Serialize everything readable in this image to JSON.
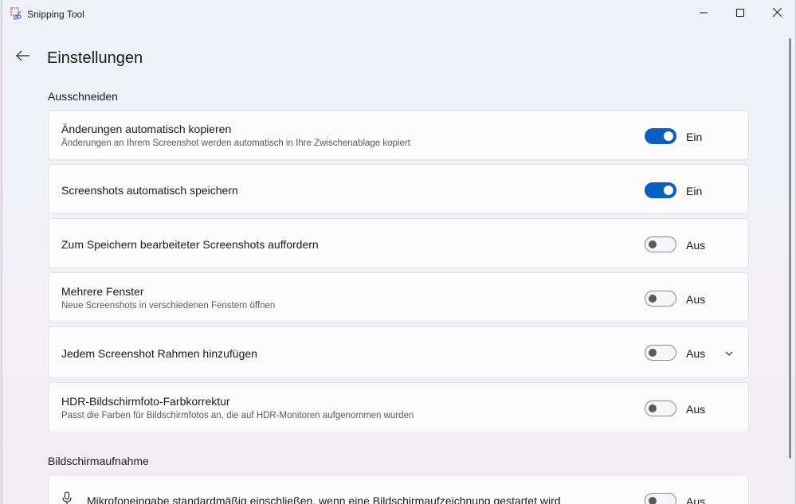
{
  "window": {
    "title": "Snipping Tool"
  },
  "header": {
    "title": "Einstellungen"
  },
  "sections": [
    {
      "title": "Ausschneiden"
    },
    {
      "title": "Bildschirmaufnahme"
    }
  ],
  "settings": [
    {
      "title": "Änderungen automatisch kopieren",
      "description": "Änderungen an Ihrem Screenshot werden automatisch in Ihre Zwischenablage kopiert",
      "state": "on",
      "state_label": "Ein"
    },
    {
      "title": "Screenshots automatisch speichern",
      "state": "on",
      "state_label": "Ein"
    },
    {
      "title": "Zum Speichern bearbeiteter Screenshots auffordern",
      "state": "off",
      "state_label": "Aus"
    },
    {
      "title": "Mehrere Fenster",
      "description": "Neue Screenshots in verschiedenen Fenstern öffnen",
      "state": "off",
      "state_label": "Aus"
    },
    {
      "title": "Jedem Screenshot Rahmen hinzufügen",
      "state": "off",
      "state_label": "Aus",
      "expandable": true
    },
    {
      "title": "HDR-Bildschirmfoto-Farbkorrektur",
      "description": "Passt die Farben für Bildschirmfotos an, die auf HDR-Monitoren aufgenommen wurden",
      "state": "off",
      "state_label": "Aus"
    },
    {
      "title": "Mikrofoneingabe standardmäßig einschließen, wenn eine Bildschirmaufzeichnung gestartet wird",
      "state": "off",
      "state_label": "Aus"
    }
  ],
  "icons": {
    "app": "snipping-tool-icon",
    "back": "back-arrow-icon",
    "minimize": "minimize-icon",
    "maximize": "maximize-icon",
    "close": "close-icon",
    "expand": "chevron-down-icon",
    "mic": "microphone-icon"
  },
  "colors": {
    "accent": "#0a5fbf",
    "card_background": "#fbfbfc",
    "window_background": "#eef1f7"
  }
}
